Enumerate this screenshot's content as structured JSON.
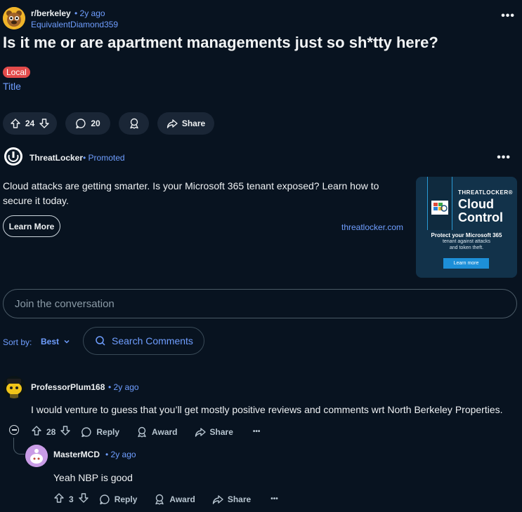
{
  "post": {
    "subreddit": "r/berkeley",
    "time": "• 2y ago",
    "author": "EquivalentDiamond359",
    "title": "Is it me or are apartment managements just so sh*tty here?",
    "flair": "Local",
    "body": "Title",
    "votes": "24",
    "comments": "20",
    "share_label": "Share",
    "more": "•••"
  },
  "ad": {
    "advertiser": "ThreatLocker",
    "promoted": "• Promoted",
    "text": "Cloud attacks are getting smarter. Is your Microsoft 365 tenant exposed? Learn how to secure it today.",
    "cta": "Learn More",
    "domain": "threatlocker.com",
    "more": "•••",
    "image": {
      "brand": "THREATLOCKER®",
      "headline_1": "Cloud",
      "headline_2": "Control",
      "subhead": "Protect your Microsoft 365",
      "subtext_1": "tenant against attacks",
      "subtext_2": "and token theft.",
      "button": "Learn more"
    }
  },
  "join": {
    "placeholder": "Join the conversation"
  },
  "sort": {
    "label": "Sort by:",
    "value": "Best"
  },
  "search": {
    "label": "Search Comments"
  },
  "comments": [
    {
      "author": "ProfessorPlum168",
      "time": "• 2y ago",
      "body": "I would venture to guess that you’ll get mostly positive reviews and comments wrt North Berkeley Properties.",
      "votes": "28",
      "reply": "Reply",
      "award": "Award",
      "share": "Share",
      "more": "•••"
    },
    {
      "author": "MasterMCD",
      "time": "• 2y ago",
      "body": "Yeah NBP is good",
      "votes": "3",
      "reply": "Reply",
      "award": "Award",
      "share": "Share",
      "more": "•••"
    }
  ],
  "colors": {
    "background": "#081320",
    "link": "#6f9eff",
    "flair": "#e34b4b",
    "pill": "#1a2636"
  }
}
